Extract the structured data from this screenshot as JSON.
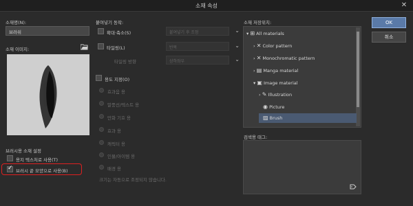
{
  "window": {
    "title": "소재 속성",
    "close_glyph": "✕"
  },
  "left": {
    "name_label": "소재명(N):",
    "name_value": "브러쉬",
    "image_label": "소재 이미지:",
    "brush_settings_label": "브러시용 소재 설정",
    "paper_texture_label": "용지 텍스처로 사용(T)",
    "paper_texture_checked": false,
    "brush_shape_label": "브러시 끝 모양으로 사용(B)",
    "brush_shape_checked": true
  },
  "middle": {
    "paste_label": "붙여넣기 동작:",
    "scale_label": "확대·축소(S)",
    "scale_mode": "붙여넣기 후 조정",
    "tile_label": "타일링(L)",
    "tile_mode": "반복",
    "tile_direction_label": "타일링 방향",
    "tile_direction_value": "상하좌우",
    "layer_label": "용도 지정(O)",
    "options": [
      "효과음 용",
      "말풍선/텍스트 용",
      "만화 기호 용",
      "효과 용",
      "캐릭터 용",
      "인물/아이템 용",
      "배경 용"
    ],
    "note": "크기는 자동으로 조정되지 않습니다."
  },
  "right": {
    "location_label": "소재 저장위치:",
    "tree": [
      {
        "label": "All materials",
        "icon": "grid-icon",
        "arrow": "▾",
        "indent": 0
      },
      {
        "label": "Color pattern",
        "icon": "pattern-icon",
        "arrow": "›",
        "indent": 1
      },
      {
        "label": "Monochromatic pattern",
        "icon": "pattern-icon",
        "arrow": "›",
        "indent": 1
      },
      {
        "label": "Manga material",
        "icon": "manga-icon",
        "arrow": "›",
        "indent": 1
      },
      {
        "label": "Image material",
        "icon": "image-icon",
        "arrow": "▾",
        "indent": 1
      },
      {
        "label": "Illustration",
        "icon": "pencil-icon",
        "arrow": "›",
        "indent": 2
      },
      {
        "label": "Picture",
        "icon": "camera-icon",
        "arrow": "",
        "indent": 2
      },
      {
        "label": "Brush",
        "icon": "brush-icon",
        "arrow": "",
        "indent": 2,
        "selected": true
      }
    ],
    "tag_label": "검색용 태그:"
  },
  "buttons": {
    "ok": "OK",
    "cancel": "취소"
  },
  "colors": {
    "accent": "#5a7aa8",
    "highlight": "#e02020",
    "selected_row": "#4a5a72"
  }
}
